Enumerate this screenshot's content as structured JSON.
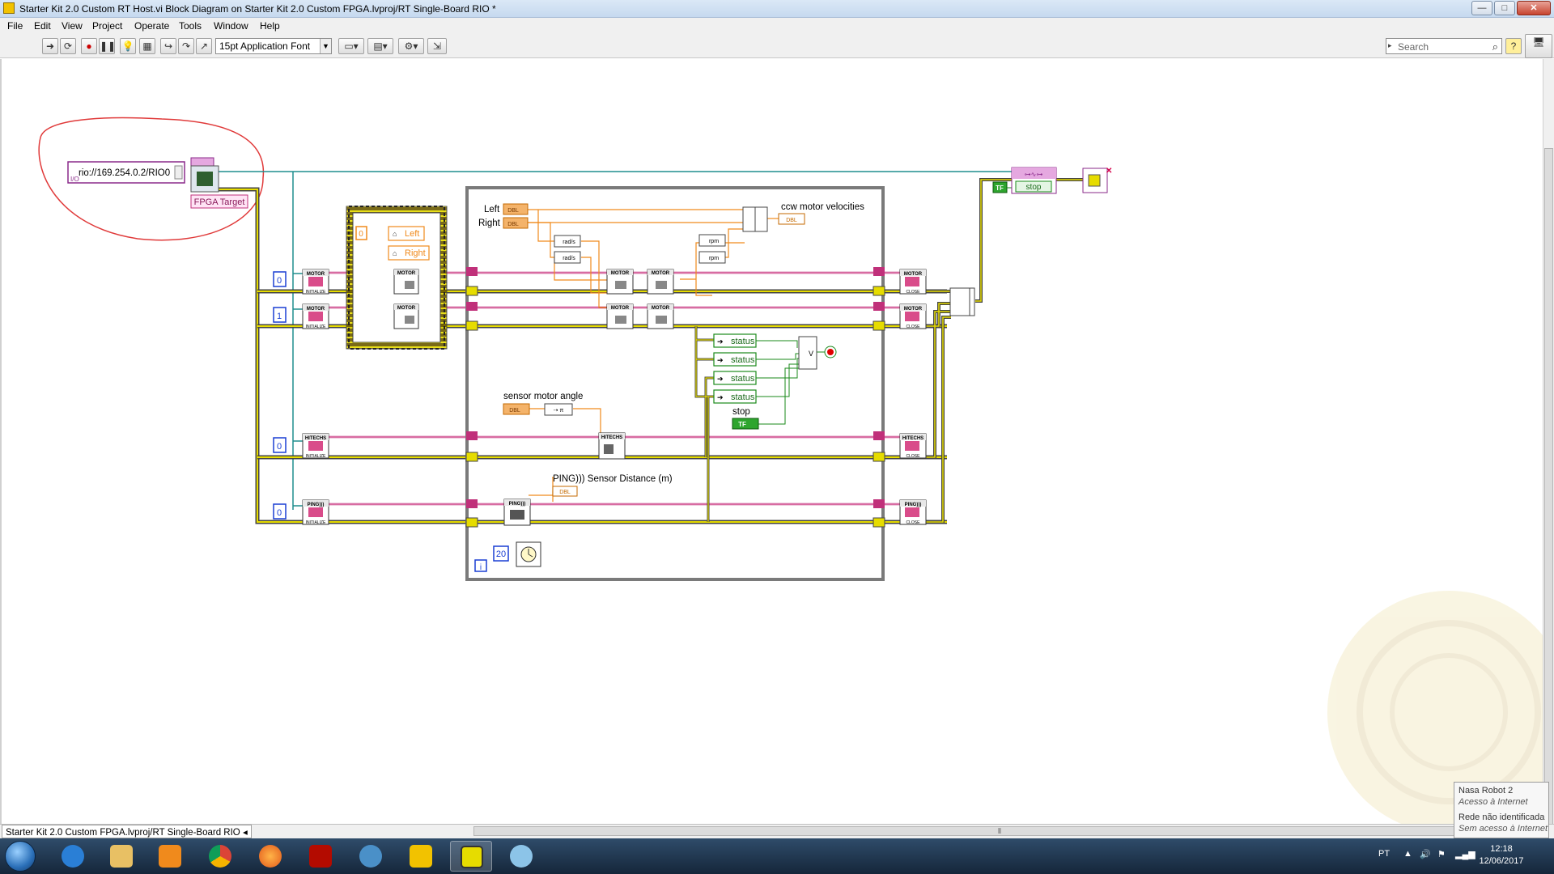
{
  "window": {
    "title": "Starter Kit 2.0 Custom RT Host.vi Block Diagram on Starter Kit 2.0 Custom FPGA.lvproj/RT Single-Board RIO *",
    "minimize": "—",
    "maximize": "□",
    "close": "✕"
  },
  "menu": [
    "File",
    "Edit",
    "View",
    "Project",
    "Operate",
    "Tools",
    "Window",
    "Help"
  ],
  "toolbar": {
    "font": "15pt Application Font",
    "search_placeholder": "Search",
    "help": "?"
  },
  "diagram": {
    "rio_address": "rio://169.254.0.2/RIO0",
    "fpga_target_label": "FPGA Target",
    "motor_index_0": "0",
    "motor_index_1": "1",
    "hitechnic_index": "0",
    "ping_index": "0",
    "sequence_const": "0",
    "left_local": "Left",
    "right_local": "Right",
    "left_label": "Left",
    "right_label": "Right",
    "dbl": "DBL",
    "rads_1": "rad/s",
    "rads_2": "rad/s",
    "rpm_1": "rpm",
    "rpm_2": "rpm",
    "ccw_label": "ccw motor velocities",
    "sensor_angle_label": "sensor motor angle",
    "ping_label": "PING))) Sensor Distance (m)",
    "status_labels": [
      "status",
      "status",
      "status",
      "status"
    ],
    "stop_label": "stop",
    "stop_const": "TF",
    "wait_ms": "20",
    "iteration": "i",
    "stop_cluster_label": "stop",
    "bool_true": "TF",
    "motor_vi": "MOTOR",
    "hitechnic_vi": "HITECHS",
    "ping_vi": "PING)))",
    "init_text": "INITIALIZE",
    "close_text": "CLOSE",
    "or_label": "V"
  },
  "statusbar": {
    "path": "Starter Kit 2.0 Custom FPGA.lvproj/RT Single-Board RIO"
  },
  "taskbar": {
    "lang": "PT",
    "time": "12:18",
    "date": "12/06/2017"
  },
  "network_popup": {
    "name": "Nasa Robot 2",
    "status1": "Acesso à Internet",
    "status2": "Rede não identificada",
    "status3": "Sem acesso à Internet"
  }
}
